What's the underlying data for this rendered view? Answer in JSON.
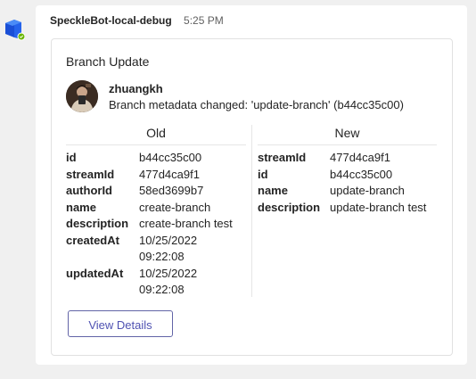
{
  "colors": {
    "background": "#f0f0f0",
    "brand_button": "#6264a7",
    "bot_icon": "#1f6feb",
    "status_green": "#6bb700"
  },
  "message": {
    "sender": "SpeckleBot-local-debug",
    "timestamp": "5:25 PM"
  },
  "card": {
    "title": "Branch Update",
    "user": "zhuangkh",
    "summary": "Branch metadata changed: 'update-branch' (b44cc35c00)",
    "old": {
      "heading": "Old",
      "facts": [
        {
          "key": "id",
          "value": "b44cc35c00"
        },
        {
          "key": "streamId",
          "value": "477d4ca9f1"
        },
        {
          "key": "authorId",
          "value": "58ed3699b7"
        },
        {
          "key": "name",
          "value": "create-branch"
        },
        {
          "key": "description",
          "value": "create-branch test"
        },
        {
          "key": "createdAt",
          "value": "10/25/2022 09:22:08"
        },
        {
          "key": "updatedAt",
          "value": "10/25/2022 09:22:08"
        }
      ]
    },
    "new": {
      "heading": "New",
      "facts": [
        {
          "key": "streamId",
          "value": "477d4ca9f1"
        },
        {
          "key": "id",
          "value": "b44cc35c00"
        },
        {
          "key": "name",
          "value": "update-branch"
        },
        {
          "key": "description",
          "value": "update-branch test"
        }
      ]
    },
    "button_label": "View Details"
  }
}
